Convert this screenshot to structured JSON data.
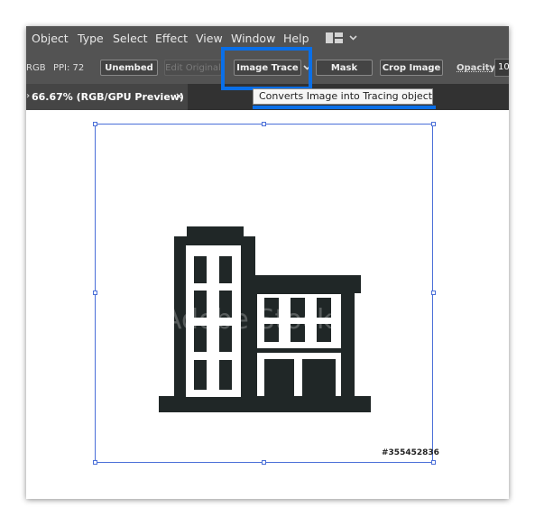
{
  "menu": {
    "items": [
      "Object",
      "Type",
      "Select",
      "Effect",
      "View",
      "Window",
      "Help"
    ]
  },
  "control_bar": {
    "color_mode": "RGB",
    "ppi": "PPI: 72",
    "unembed": "Unembed",
    "edit_original": "Edit Original",
    "image_trace": "Image Trace",
    "mask": "Mask",
    "crop_image": "Crop Image",
    "opacity_label": "Opacity:",
    "opacity_value": "10"
  },
  "document_tab": {
    "title": "66.67% (RGB/GPU Preview)",
    "close": "×"
  },
  "tooltip": {
    "text": "Converts Image into Tracing object"
  },
  "canvas": {
    "watermark": "Adobe Stock",
    "stock_id": "#355452836"
  },
  "colors": {
    "highlight": "#0a6fe8",
    "building": "#202727",
    "selection": "#4a6fd8"
  }
}
